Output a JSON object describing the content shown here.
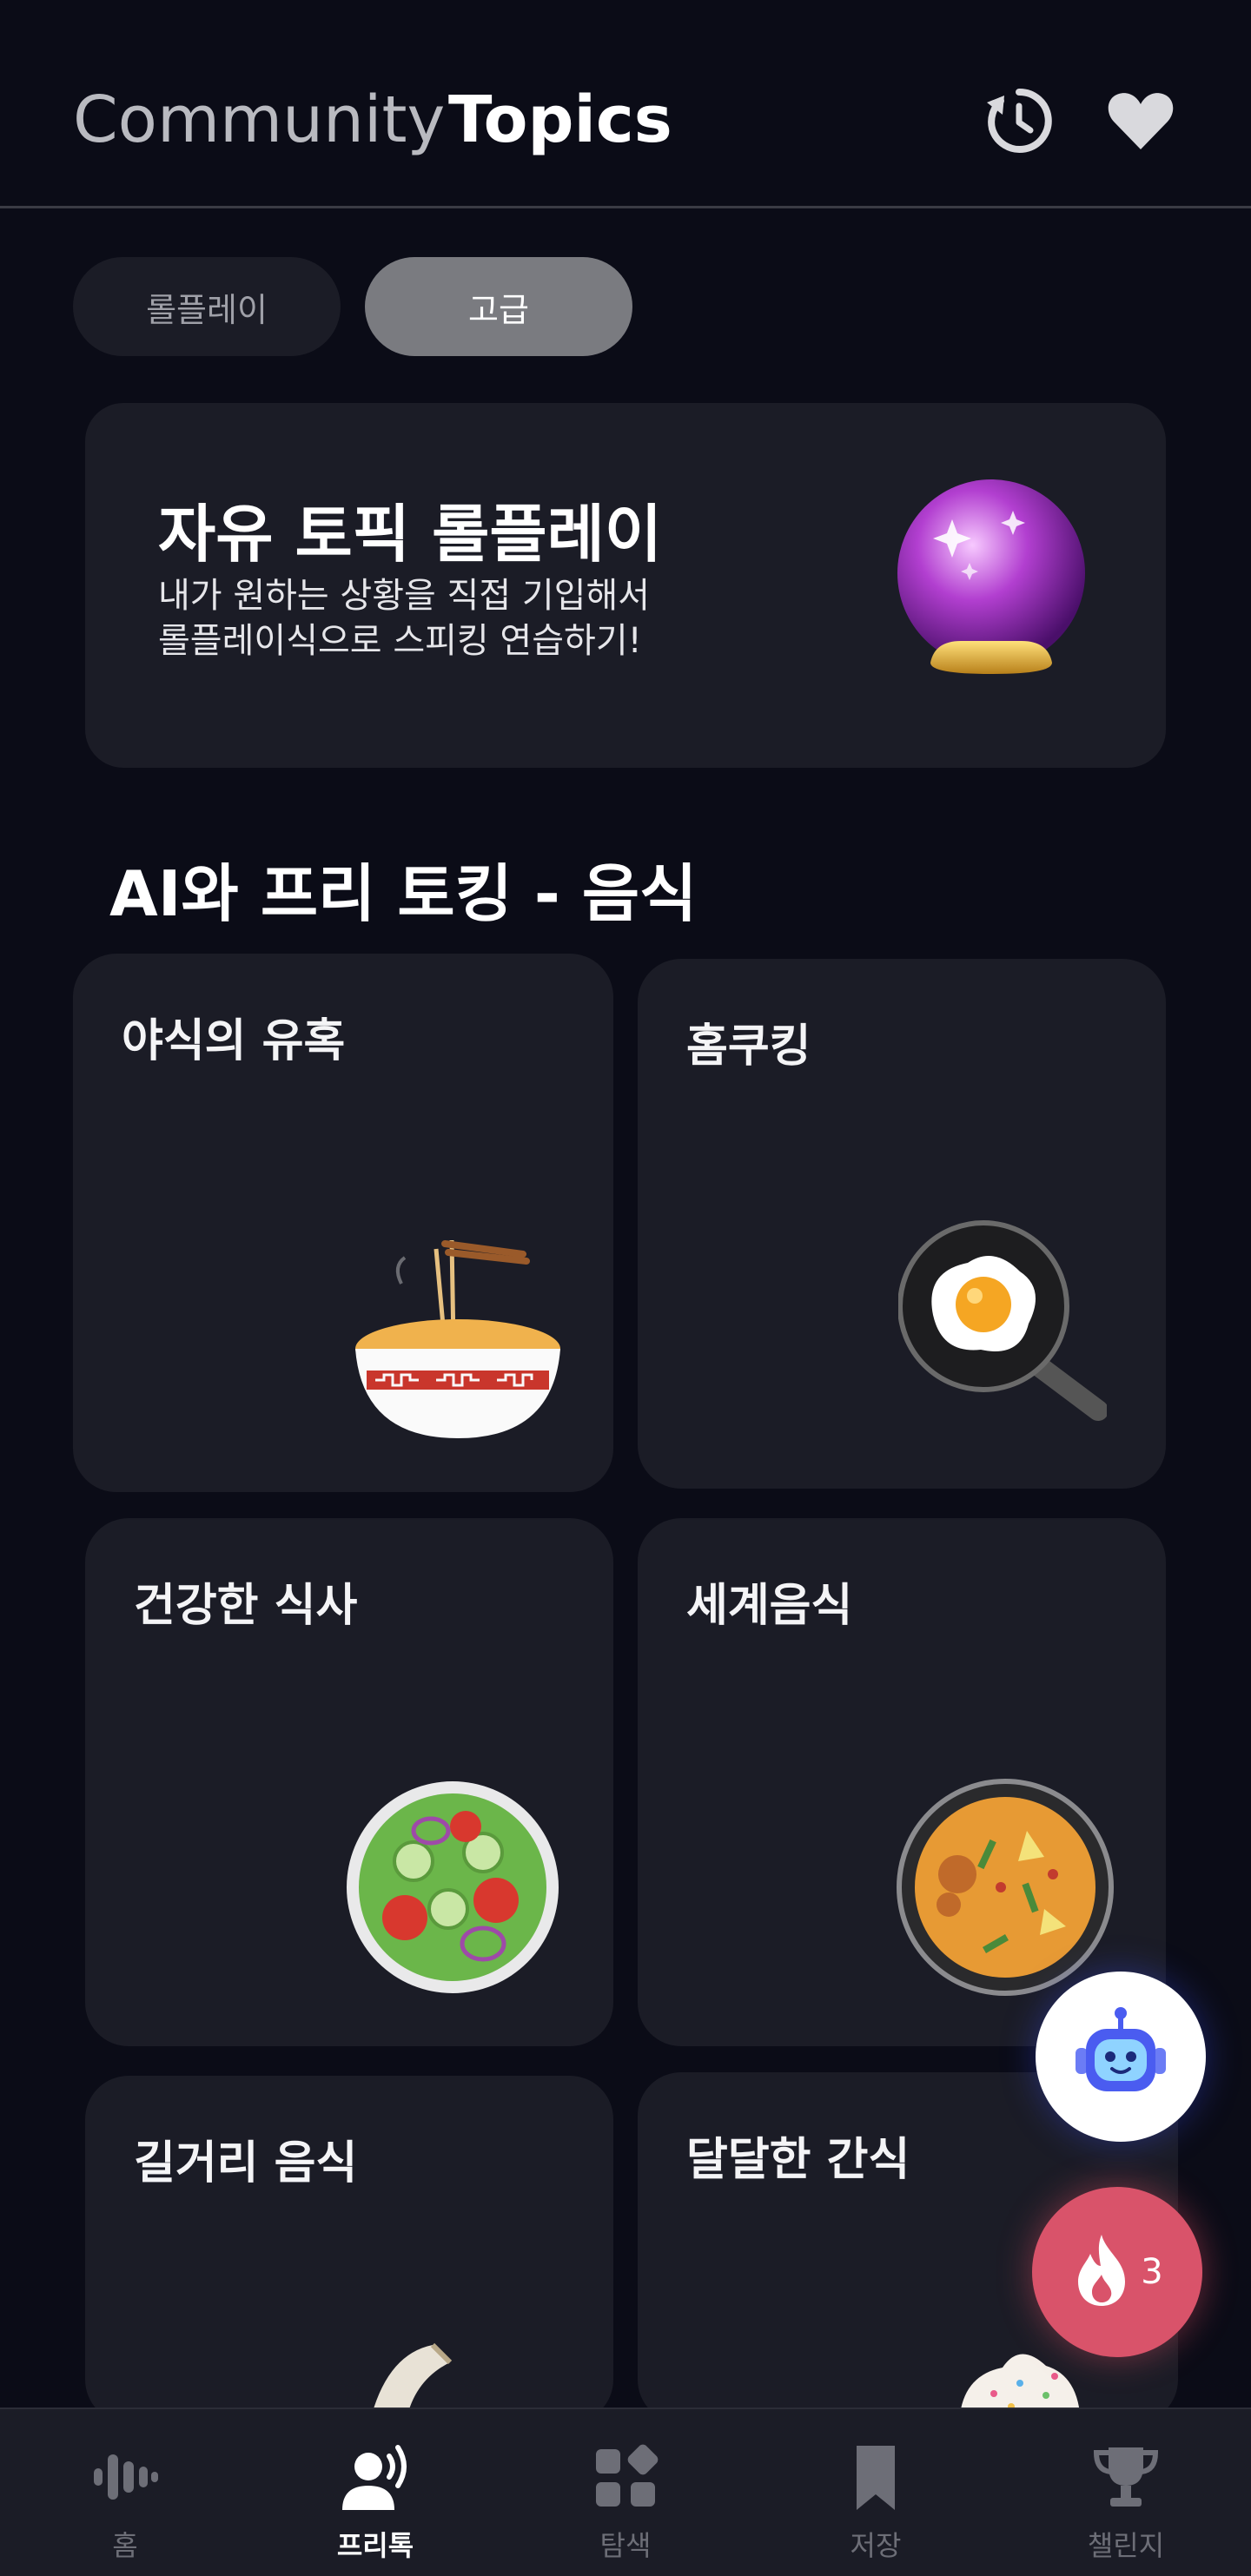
{
  "header": {
    "tab_community": "Community",
    "tab_topics": "Topics",
    "history_icon": "history-icon",
    "favorites_icon": "heart-icon"
  },
  "filters": {
    "roleplay": "롤플레이",
    "advanced": "고급",
    "active": "advanced"
  },
  "banner": {
    "title": "자유 토픽 롤플레이",
    "desc_line1": "내가 원하는 상황을 직접 기입해서",
    "desc_line2": "롤플레이식으로 스피킹 연습하기!",
    "icon": "crystal-ball-icon"
  },
  "section": {
    "title": "AI와 프리 토킹 - 음식"
  },
  "cards": [
    {
      "title": "야식의 유혹",
      "icon": "noodle-bowl-icon"
    },
    {
      "title": "홈쿠킹",
      "icon": "frying-egg-icon"
    },
    {
      "title": "건강한 식사",
      "icon": "salad-icon"
    },
    {
      "title": "세계음식",
      "icon": "paella-icon"
    },
    {
      "title": "길거리 음식",
      "icon": "street-food-icon"
    },
    {
      "title": "달달한 간식",
      "icon": "dessert-icon"
    }
  ],
  "fab": {
    "bot_icon": "robot-icon",
    "streak_icon": "flame-icon",
    "streak_count": "3"
  },
  "nav": [
    {
      "label": "홈",
      "icon": "voice-wave-icon",
      "active": false
    },
    {
      "label": "프리톡",
      "icon": "speaking-person-icon",
      "active": true
    },
    {
      "label": "탐색",
      "icon": "grid-explore-icon",
      "active": false
    },
    {
      "label": "저장",
      "icon": "bookmark-icon",
      "active": false
    },
    {
      "label": "챌린지",
      "icon": "trophy-icon",
      "active": false
    }
  ],
  "colors": {
    "background": "#0b0c17",
    "card": "#1b1c26",
    "chip_active": "#7a7b80",
    "streak": "#d9536a",
    "bot_accent": "#4a5cf0"
  }
}
